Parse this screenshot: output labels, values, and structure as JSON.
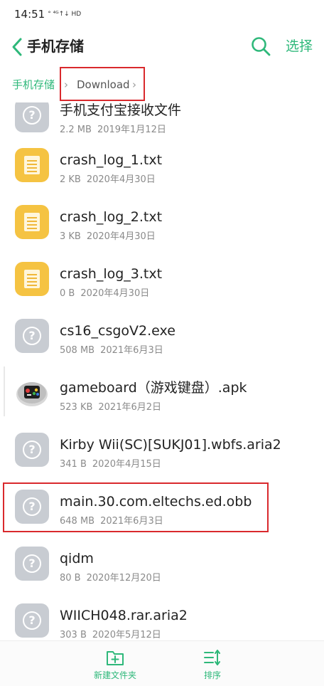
{
  "status_bar": {
    "time": "14:51",
    "signal": "° ⁴ᴳ↑↓ HD"
  },
  "header": {
    "title": "手机存储",
    "select_label": "选择"
  },
  "breadcrumb": {
    "root": "手机存储",
    "current": "Download",
    "separator": "›"
  },
  "files": [
    {
      "name": "手机支付宝接收文件",
      "size": "2.2 MB",
      "date": "2019年1月12日",
      "icon": "unknown-file-icon"
    },
    {
      "name": "crash_log_1.txt",
      "size": "2 KB",
      "date": "2020年4月30日",
      "icon": "text-file-icon"
    },
    {
      "name": "crash_log_2.txt",
      "size": "3 KB",
      "date": "2020年4月30日",
      "icon": "text-file-icon"
    },
    {
      "name": "crash_log_3.txt",
      "size": "0 B",
      "date": "2020年4月30日",
      "icon": "text-file-icon"
    },
    {
      "name": "cs16_csgoV2.exe",
      "size": "508 MB",
      "date": "2021年6月3日",
      "icon": "unknown-file-icon"
    },
    {
      "name": "gameboard（游戏键盘）.apk",
      "size": "523 KB",
      "date": "2021年6月2日",
      "icon": "gamepad-app-icon"
    },
    {
      "name": "Kirby Wii(SC)[SUKJ01].wbfs.aria2",
      "size": "341 B",
      "date": "2020年4月15日",
      "icon": "unknown-file-icon"
    },
    {
      "name": "main.30.com.eltechs.ed.obb",
      "size": "648 MB",
      "date": "2021年6月3日",
      "icon": "unknown-file-icon"
    },
    {
      "name": "qidm",
      "size": "80 B",
      "date": "2020年12月20日",
      "icon": "unknown-file-icon"
    },
    {
      "name": "WIICH048.rar.aria2",
      "size": "303 B",
      "date": "2020年5月12日",
      "icon": "unknown-file-icon"
    }
  ],
  "bottom_bar": {
    "new_folder": "新建文件夹",
    "sort": "排序"
  },
  "colors": {
    "accent": "#2eb87a",
    "highlight": "#d9292d",
    "text_icon": "#f5c342",
    "unknown_icon": "#c8ccd2"
  }
}
